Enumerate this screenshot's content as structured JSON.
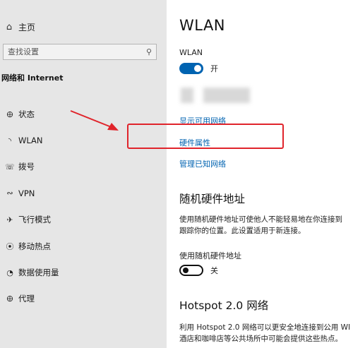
{
  "sidebar": {
    "home_label": "主页",
    "search_placeholder": "查找设置",
    "section_title": "网络和 Internet",
    "items": [
      {
        "label": "状态",
        "icon": "globe-icon"
      },
      {
        "label": "WLAN",
        "icon": "wifi-icon"
      },
      {
        "label": "拨号",
        "icon": "phone-icon"
      },
      {
        "label": "VPN",
        "icon": "vpn-icon"
      },
      {
        "label": "飞行模式",
        "icon": "airplane-icon"
      },
      {
        "label": "移动热点",
        "icon": "hotspot-icon"
      },
      {
        "label": "数据使用量",
        "icon": "data-usage-icon"
      },
      {
        "label": "代理",
        "icon": "globe-icon"
      }
    ]
  },
  "main": {
    "title": "WLAN",
    "wlan_label": "WLAN",
    "wlan_toggle_state": "开",
    "links": {
      "show_available": "显示可用网络",
      "hardware_properties": "硬件属性",
      "manage_known": "管理已知网络"
    },
    "random_mac": {
      "heading": "随机硬件地址",
      "description": "使用随机硬件地址可使他人不能轻易地在你连接到\n跟踪你的位置。此设置适用于新连接。",
      "toggle_label": "使用随机硬件地址",
      "toggle_state": "关"
    },
    "hotspot": {
      "heading": "Hotspot 2.0 网络",
      "description": "利用 Hotspot 2.0 网络可以更安全地连接到公用 WI\n酒店和咖啡店等公共场所中可能会提供这些热点。"
    }
  },
  "colors": {
    "accent": "#0063b1",
    "sidebar_bg": "#e6e6e6",
    "annotation_red": "#e0242b"
  }
}
